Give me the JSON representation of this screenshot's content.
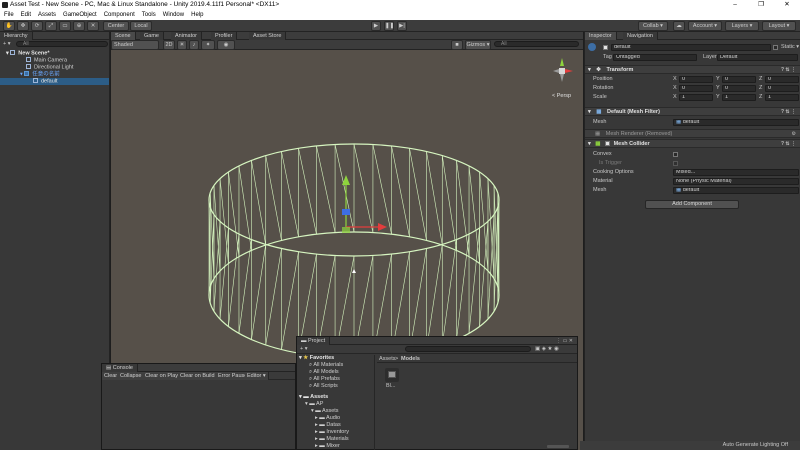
{
  "window": {
    "title": "Asset Test - New Scene - PC, Mac & Linux Standalone - Unity 2019.4.11f1 Personal* <DX11>",
    "controls": [
      "–",
      "❐",
      "✕"
    ]
  },
  "menu": [
    "File",
    "Edit",
    "Assets",
    "GameObject",
    "Component",
    "Tools",
    "Window",
    "Help"
  ],
  "toolbar": {
    "pivot": "Center",
    "space": "Local",
    "collab": "Collab ▾",
    "account": "Account ▾",
    "layers": "Layers ▾",
    "layout": "Layout ▾"
  },
  "hierarchy": {
    "tab": "Hierarchy",
    "search_placeholder": "All",
    "add": "+ ▾",
    "items": [
      {
        "label": "New Scene*",
        "bold": true
      },
      {
        "label": "Main Camera"
      },
      {
        "label": "Directional Light"
      },
      {
        "label": "任意の名前"
      },
      {
        "label": "default"
      }
    ]
  },
  "scene": {
    "tabs": [
      "Scene",
      "Game",
      "Animator",
      "Profiler",
      "Asset Store"
    ],
    "shading": "Shaded",
    "mode_2d": "2D",
    "gizmos": "Gizmos ▾",
    "search_placeholder": "All",
    "gizmo_label": "< Persp"
  },
  "inspector": {
    "tabs": [
      "Inspector",
      "Navigation"
    ],
    "object_name": "default",
    "static": "Static ▾",
    "tag_label": "Tag",
    "tag_value": "Untagged",
    "layer_label": "Layer",
    "layer_value": "Default",
    "transform": {
      "title": "Transform",
      "rows": [
        {
          "label": "Position",
          "x": "0",
          "y": "0",
          "z": "0"
        },
        {
          "label": "Rotation",
          "x": "0",
          "y": "0",
          "z": "0"
        },
        {
          "label": "Scale",
          "x": "1",
          "y": "1",
          "z": "1"
        }
      ]
    },
    "mesh_filter": {
      "title": "Default (Mesh Filter)",
      "mesh_label": "Mesh",
      "mesh_value": "default"
    },
    "mesh_renderer": {
      "title": "Mesh Renderer (Removed)"
    },
    "mesh_collider": {
      "title": "Mesh Collider",
      "convex_label": "Convex",
      "trigger_label": "Is Trigger",
      "cooking_label": "Cooking Options",
      "cooking_value": "Mixed...",
      "material_label": "Material",
      "material_value": "None (Physic Material)",
      "mesh_label": "Mesh",
      "mesh_value": "default"
    },
    "add_component": "Add Component"
  },
  "console": {
    "tab": "Console",
    "buttons": [
      "Clear",
      "Collapse",
      "Clear on Play",
      "Clear on Build",
      "Error Pause",
      "Editor ▾"
    ]
  },
  "project": {
    "tab": "Project",
    "search_placeholder": "",
    "favorites": "Favorites",
    "fav_items": [
      "All Materials",
      "All Models",
      "All Prefabs",
      "All Scripts"
    ],
    "assets": "Assets",
    "tree": [
      "AP",
      "Assets",
      "Audio",
      "Datas",
      "Inventory",
      "Materials",
      "Mixer"
    ],
    "breadcrumb": [
      "Assets",
      "Models"
    ],
    "file_label": "Bl..."
  },
  "status": {
    "text": "Auto Generate Lighting Off"
  }
}
